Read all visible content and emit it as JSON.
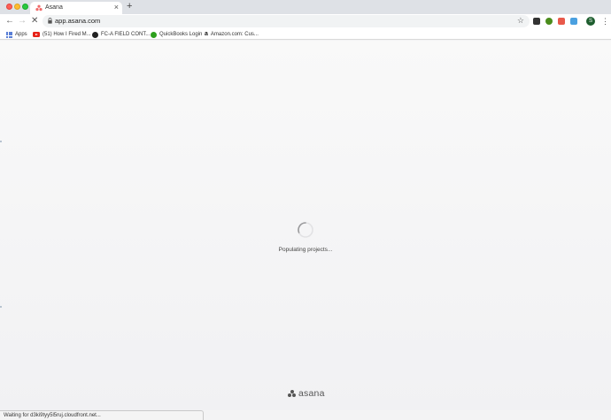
{
  "tab": {
    "title": "Asana",
    "close": "×",
    "new_tab": "+"
  },
  "toolbar": {
    "back": "←",
    "forward": "→",
    "stop": "✕",
    "url": "app.asana.com",
    "star": "☆",
    "profile_initial": "S",
    "menu": "⋮"
  },
  "bookmarks": {
    "apps": "Apps",
    "items": [
      {
        "label": "(51) How I Fired M...",
        "icon": "youtube-icon"
      },
      {
        "label": "FC-A FIELD CONT...",
        "icon": "globe-icon"
      },
      {
        "label": "QuickBooks Login",
        "icon": "quickbooks-icon"
      },
      {
        "label": "Amazon.com: Cus...",
        "icon": "amazon-icon"
      }
    ]
  },
  "page": {
    "loading_text": "Populating projects...",
    "logo_text": "asana"
  },
  "status": {
    "text": "Waiting for d3ki9tyy5l5ruj.cloudfront.net..."
  },
  "colors": {
    "traffic_close": "#ff5f57",
    "traffic_min": "#febc2e",
    "traffic_max": "#28c840",
    "profile": "#1d5d2e"
  }
}
